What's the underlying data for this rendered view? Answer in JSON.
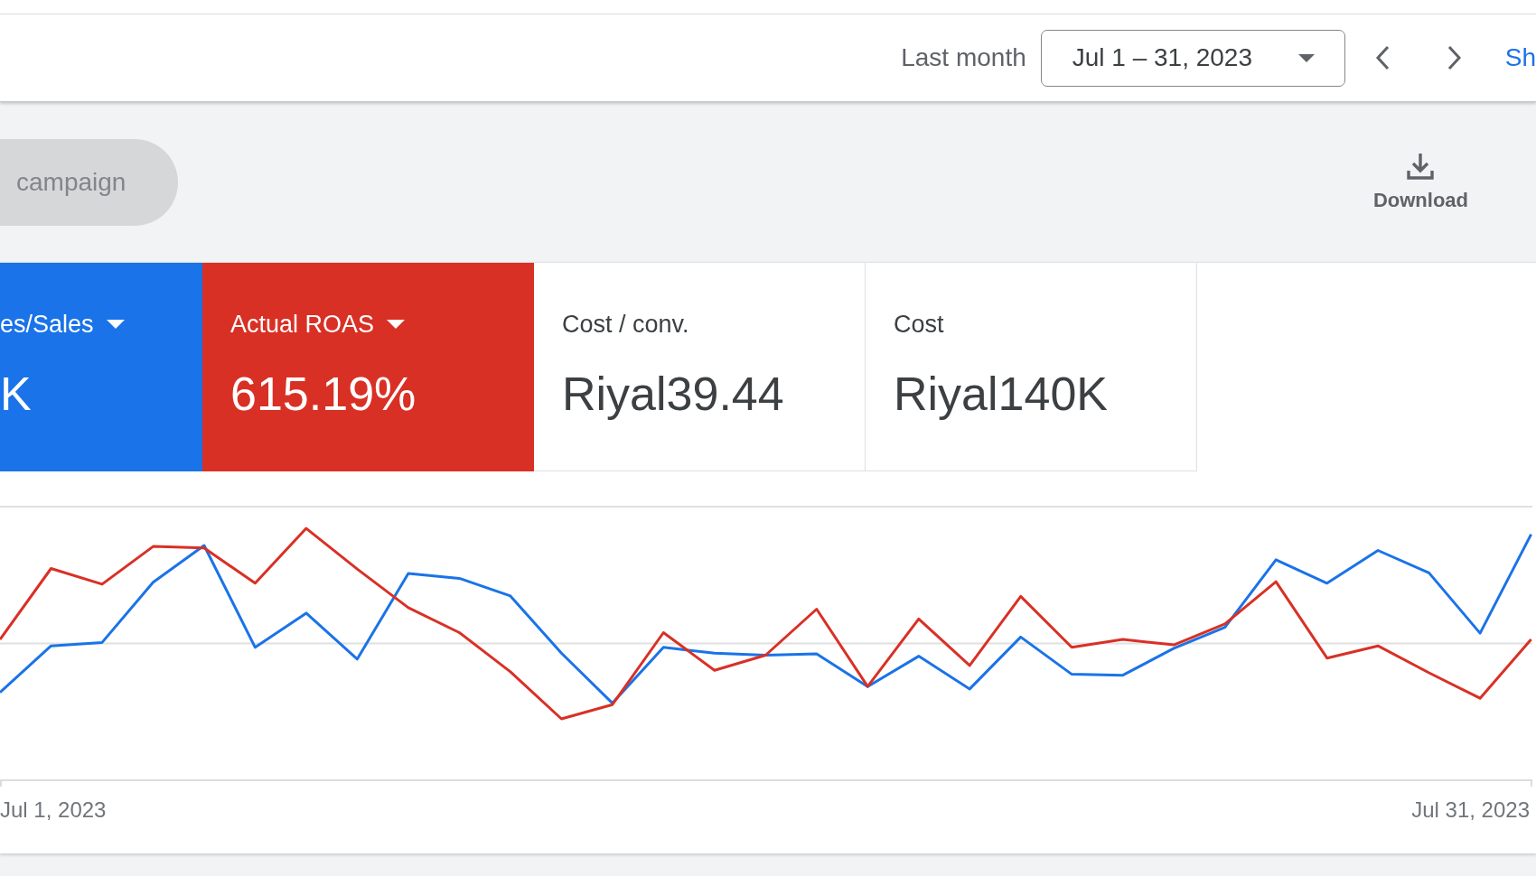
{
  "date_bar": {
    "preset_label": "Last month",
    "date_range": "Jul 1 – 31, 2023",
    "link": "Sh"
  },
  "toolbar": {
    "campaign_button": "campaign",
    "download_button": "Download"
  },
  "scorecards": [
    {
      "title": "es/Sales",
      "value": "K",
      "selected": true,
      "color": "#1a73e8"
    },
    {
      "title": "Actual ROAS",
      "value": "615.19%",
      "selected": true,
      "color": "#d93025"
    },
    {
      "title": "Cost / conv.",
      "value": "Riyal39.44",
      "selected": false
    },
    {
      "title": "Cost",
      "value": "Riyal140K",
      "selected": false
    }
  ],
  "chart": {
    "x_labels": [
      "Jul 1, 2023",
      "Jul 31, 2023"
    ]
  }
}
